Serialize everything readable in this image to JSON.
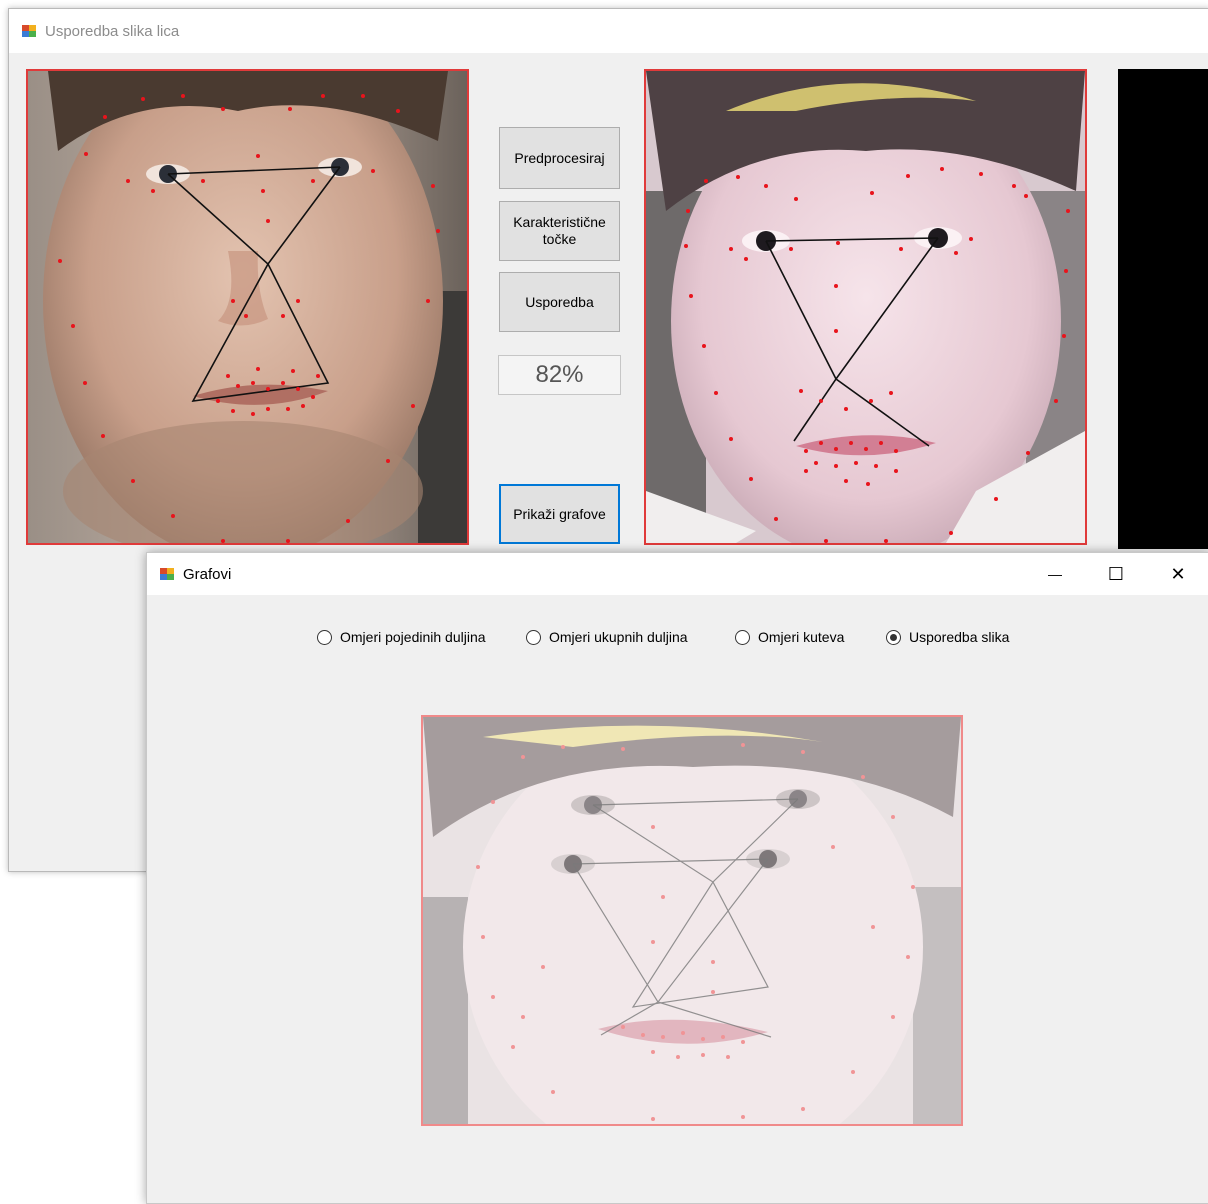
{
  "main_window": {
    "title": "Usporedba slika lica",
    "buttons": {
      "preprocess": "Predprocesiraj",
      "landmarks_line1": "Karakteristične",
      "landmarks_line2": "točke",
      "compare": "Usporedba",
      "show_graphs": "Prikaži grafove"
    },
    "result": "82%"
  },
  "graphs_window": {
    "title": "Grafovi",
    "controls": {
      "minimize": "—",
      "maximize": "☐",
      "close": "✕"
    },
    "radios": [
      {
        "label": "Omjeri pojedinih duljina",
        "selected": false
      },
      {
        "label": "Omjeri ukupnih duljina",
        "selected": false
      },
      {
        "label": "Omjeri kuteva",
        "selected": false
      },
      {
        "label": "Usporedba slika",
        "selected": true
      }
    ]
  },
  "colors": {
    "landmark_dot": "#e8141c",
    "panel_border": "#e03a3a",
    "focus_border": "#0078d7"
  }
}
